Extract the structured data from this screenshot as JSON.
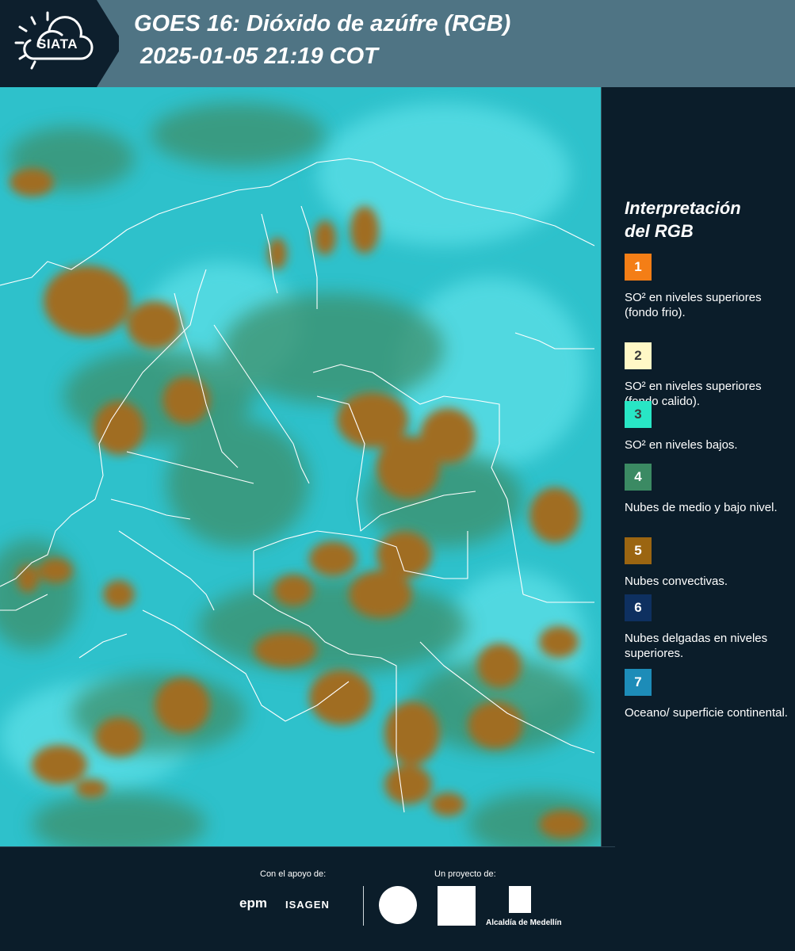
{
  "header": {
    "logo_text": "SIATA",
    "title_line1": "GOES 16: Dióxido de azúfre (RGB)",
    "title_line2": "2025-01-05 21:19 COT"
  },
  "legend": {
    "title_line1": "Interpretación",
    "title_line2": "del RGB",
    "items": [
      {
        "number": "1",
        "label": "SO² en niveles superiores (fondo frio).",
        "color": "#f47e16"
      },
      {
        "number": "2",
        "label": "SO² en niveles superiores (fondo calido).",
        "color": "#fff8c6"
      },
      {
        "number": "3",
        "label": "SO² en niveles bajos.",
        "color": "#28e6c5"
      },
      {
        "number": "4",
        "label": "Nubes de medio y bajo nivel.",
        "color": "#3b8a63"
      },
      {
        "number": "5",
        "label": "Nubes convectivas.",
        "color": "#9b6511"
      },
      {
        "number": "6",
        "label": "Nubes delgadas en niveles superiores.",
        "color": "#0e3060"
      },
      {
        "number": "7",
        "label": "Oceano/ superficie continental.",
        "color": "#1d8cb8"
      }
    ]
  },
  "footer": {
    "support_caption": "Con el apoyo de:",
    "project_caption": "Un proyecto de:",
    "epm_text": "epm",
    "isagen_text": "ISAGEN",
    "alcaldia_text": "Alcaldía de Medellín"
  },
  "colors": {
    "background": "#0b1d2a",
    "header": "#4f7484",
    "map_base": "#2fc4cd",
    "convective": "#a06d20",
    "mid_low_clouds": "#3d8f6a"
  }
}
